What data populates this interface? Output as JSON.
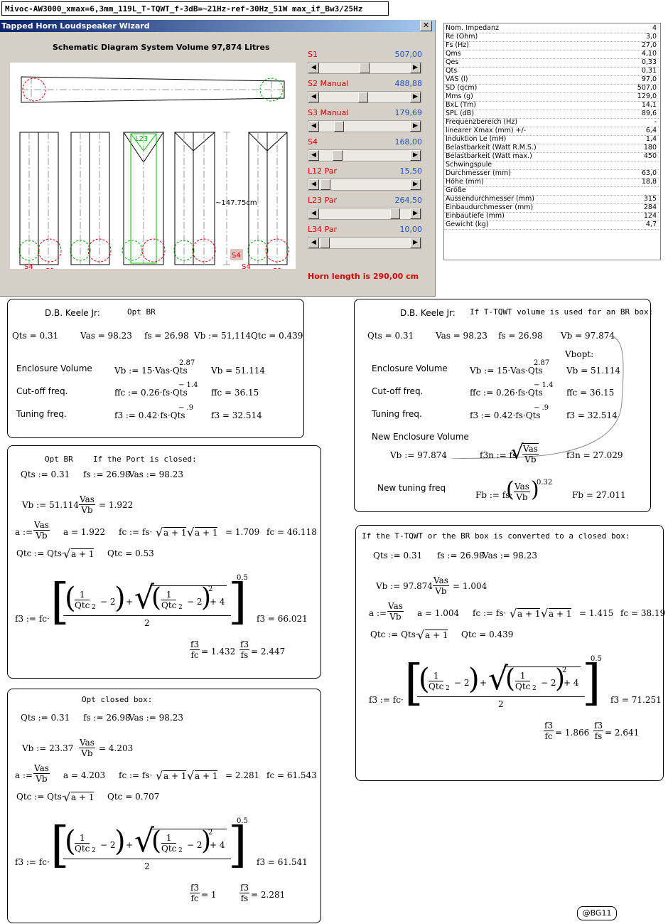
{
  "title_bar": "Mivoc-AW3000_xmax=6,3mm_119L_T-TQWT_f-3dB=~21Hz-ref-30Hz_51W max_if_Bw3/25Hz",
  "wizard": {
    "window_title": "Tapped Horn Loudspeaker Wizard",
    "close_glyph": "✕",
    "caption": "Schematic Diagram    System Volume 97,874 Litres",
    "diagram": {
      "dim_label": "~147.75cm",
      "dim_unit": "cm",
      "s1a": "S1",
      "s1b": "S1",
      "s4a": "S4",
      "s4b": "S4",
      "s4mid": "S4",
      "l23": "L23"
    },
    "sliders": [
      {
        "label": "S1",
        "value": "507,00",
        "level": 0.5
      },
      {
        "label": "S2  Manual",
        "value": "488,88",
        "level": 0.48
      },
      {
        "label": "S3  Manual",
        "value": "179,69",
        "level": 0.18
      },
      {
        "label": "S4",
        "value": "168,00",
        "level": 0.17
      },
      {
        "label": "L12  Par",
        "value": "15,50",
        "level": 0.02
      },
      {
        "label": "L23  Par",
        "value": "264,50",
        "level": 0.88
      },
      {
        "label": "L34  Par",
        "value": "10,00",
        "level": 0.01
      }
    ],
    "horn_length": "Horn length is 290,00 cm"
  },
  "params": [
    {
      "label": "Nom. Impedanz",
      "value": "4"
    },
    {
      "label": "Re (Ohm)",
      "value": "3,0"
    },
    {
      "label": "Fs (Hz)",
      "value": "27,0"
    },
    {
      "label": "Qms",
      "value": "4,10"
    },
    {
      "label": "Qes",
      "value": "0,33"
    },
    {
      "label": "Qts",
      "value": "0,31"
    },
    {
      "label": "VAS (l)",
      "value": "97,0"
    },
    {
      "label": "SD (qcm)",
      "value": "507,0"
    },
    {
      "label": "Mms (g)",
      "value": "129,0"
    },
    {
      "label": "BxL (Tm)",
      "value": "14,1"
    },
    {
      "label": "SPL (dB)",
      "value": "89,6"
    },
    {
      "label": "Frequenzbereich (Hz)",
      "value": "-"
    },
    {
      "label": "linearer Xmax (mm) +/-",
      "value": "6,4"
    },
    {
      "label": "Induktion Le (mH)",
      "value": "1,4"
    },
    {
      "label": "Belastbarkeit (Watt R.M.S.)",
      "value": "180"
    },
    {
      "label": "Belastbarkeit (Watt max.)",
      "value": "450"
    },
    {
      "label": "Schwingspule",
      "value": ""
    },
    {
      "label": "Durchmesser (mm)",
      "value": "63,0"
    },
    {
      "label": "Höhe (mm)",
      "value": "18,8"
    },
    {
      "label": "Größe",
      "value": ""
    },
    {
      "label": "Aussendurchmesser (mm)",
      "value": "315"
    },
    {
      "label": "Einbaudurchmesser (mm)",
      "value": "284"
    },
    {
      "label": "Einbautiefe (mm)",
      "value": "124"
    },
    {
      "label": "Gewicht (kg)",
      "value": "4,7"
    }
  ],
  "p1": {
    "h1": "D.B. Keele Jr:",
    "h2": "Opt BR",
    "row": [
      "Qts = 0.31",
      "Vas = 98.23",
      "fs = 26.98",
      "Vb := 51,114",
      "Qtc = 0.439"
    ],
    "ev": "Enclosure Volume",
    "ev_f": "Vb := 15·Vas·Qts",
    "ev_e": "2.87",
    "ev_r": "Vb = 51.114",
    "cf": "Cut-off freq.",
    "cf_f": "ffc := 0.26·fs·Qts",
    "cf_e": "− 1.4",
    "cf_r": "ffc = 36.15",
    "tf": "Tuning freq.",
    "tf_f": "f3 := 0.42·fs·Qts",
    "tf_e": "− .9",
    "tf_r": "f3 = 32.514"
  },
  "p2": {
    "h1": "D.B. Keele Jr:",
    "h2": "If T-TQWT volume is used for an BR box:",
    "row": [
      "Qts = 0.31",
      "Vas = 98.23",
      "fs = 26.98",
      "Vb = 97.874"
    ],
    "vbopt": "Vbopt:",
    "ev": "Enclosure Volume",
    "ev_f": "Vb := 15·Vas·Qts",
    "ev_e": "2.87",
    "ev_r": "Vb = 51.114",
    "cf": "Cut-off freq.",
    "cf_f": "ffc := 0.26·fs·Qts",
    "cf_e": "− 1.4",
    "cf_r": "ffc = 36.15",
    "tf": "Tuning freq.",
    "tf_f": "f3 := 0.42·fs·Qts",
    "tf_e": "− .9",
    "tf_r": "f3 = 32.514",
    "nev": "New Enclosure Volume",
    "nev_vb": "Vb := 97.874",
    "f3n_l": "f3n := fs·",
    "f3n_r": "f3n = 27.029",
    "ntf": "New tuning freq",
    "fb_l": "Fb := fs·",
    "fb_e": "0.32",
    "fb_r": "Fb = 27.011",
    "vas": "Vas",
    "vb": "Vb"
  },
  "p3": {
    "h1": "Opt BR",
    "h2": "If the Port is closed:",
    "row": [
      "Qts := 0.31",
      "fs := 26.98",
      "Vas := 98.23"
    ],
    "vb": "Vb := 51.114",
    "ratio_r": "= 1.922",
    "a_l": "a :=",
    "a_r": "a = 1.922",
    "fc_f": "fc := fs·",
    "sq_r": "= 1.709",
    "fc_r": "fc = 46.118",
    "qtc_f": "Qtc := Qts·",
    "qtc_r": "Qtc = 0.53",
    "f3_l": "f3 := fc·",
    "f3_r": "f3 = 66.021",
    "exp": "0.5",
    "r1": "= 1.432",
    "r2": "= 2.447"
  },
  "p4": {
    "h": "If the T-TQWT or the BR box is converted to a closed box:",
    "row": [
      "Qts := 0.31",
      "fs := 26.98",
      "Vas := 98.23"
    ],
    "vb": "Vb := 97.874",
    "ratio_r": "= 1.004",
    "a_l": "a :=",
    "a_r": "a = 1.004",
    "fc_f": "fc := fs·",
    "sq_r": "= 1.415",
    "fc_r": "fc = 38.19",
    "qtc_f": "Qtc := Qts·",
    "qtc_r": "Qtc = 0.439",
    "f3_l": "f3 := fc·",
    "f3_r": "f3 = 71.251",
    "exp": "0.5",
    "r1": "= 1.866",
    "r2": "= 2.641"
  },
  "p5": {
    "h": "Opt closed box:",
    "row": [
      "Qts := 0.31",
      "fs := 26.98",
      "Vas := 98.23"
    ],
    "vb": "Vb := 23.37",
    "ratio_r": "= 4.203",
    "a_l": "a :=",
    "a_r": "a = 4.203",
    "fc_f": "fc := fs·",
    "sq_r": "= 2.281",
    "fc_r": "fc = 61.543",
    "qtc_f": "Qtc := Qts·",
    "qtc_r": "Qtc = 0.707",
    "f3_l": "f3 := fc·",
    "f3_r": "f3 = 61.541",
    "exp": "0.5",
    "r1": "= 1",
    "r2": "= 2.281"
  },
  "sym": {
    "vas": "Vas",
    "vb": "Vb",
    "f3": "f3",
    "fc": "fc",
    "fs": "fs",
    "a1": "a + 1",
    "one": "1",
    "qtc": "Qtc",
    "two": "2",
    "four": "4",
    "minus2": "− 2",
    "plus": "+",
    "sq": "2"
  },
  "badge": "@BG11"
}
